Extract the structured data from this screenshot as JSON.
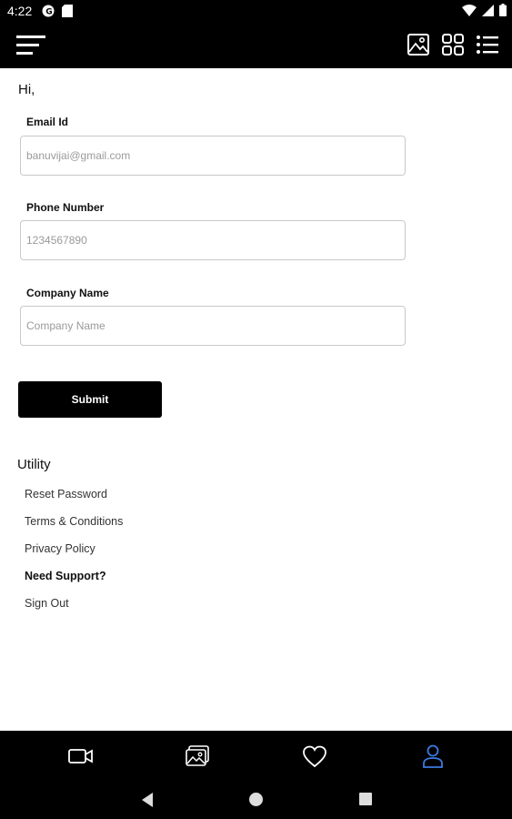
{
  "status_bar": {
    "time": "4:22"
  },
  "greeting": "Hi,",
  "form": {
    "email": {
      "label": "Email Id",
      "placeholder": "banuvijai@gmail.com"
    },
    "phone": {
      "label": "Phone Number",
      "placeholder": "1234567890"
    },
    "company": {
      "label": "Company Name",
      "placeholder": "Company Name"
    },
    "submit_label": "Submit"
  },
  "utility": {
    "title": "Utility",
    "items": [
      {
        "label": "Reset Password",
        "bold": false
      },
      {
        "label": "Terms & Conditions",
        "bold": false
      },
      {
        "label": "Privacy Policy",
        "bold": false
      },
      {
        "label": "Need Support?",
        "bold": true
      },
      {
        "label": "Sign Out",
        "bold": false
      }
    ]
  },
  "bottom_nav": {
    "items": [
      "video-icon",
      "gallery-icon",
      "heart-icon",
      "profile-icon"
    ],
    "active": "profile-icon",
    "active_color": "#3b7be0",
    "inactive_color": "#ffffff"
  },
  "colors": {
    "bars": "#000000",
    "button": "#000000"
  }
}
